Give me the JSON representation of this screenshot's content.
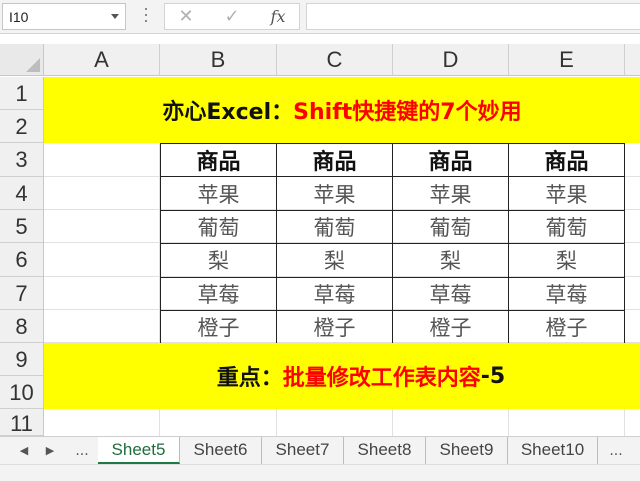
{
  "name_box": {
    "value": "I10"
  },
  "formula_bar": {
    "cancel_icon": "✕",
    "enter_icon": "✓",
    "fx_label": "fx",
    "value": ""
  },
  "columns": [
    "A",
    "B",
    "C",
    "D",
    "E"
  ],
  "rows": [
    "1",
    "2",
    "3",
    "4",
    "5",
    "6",
    "7",
    "8",
    "9",
    "10",
    "11"
  ],
  "title_banner": {
    "part1": "亦心Excel：",
    "part2": "Shift快捷键的7个妙用"
  },
  "table": {
    "header": [
      "商品",
      "商品",
      "商品",
      "商品"
    ],
    "rows": [
      [
        "苹果",
        "苹果",
        "苹果",
        "苹果"
      ],
      [
        "葡萄",
        "葡萄",
        "葡萄",
        "葡萄"
      ],
      [
        "梨",
        "梨",
        "梨",
        "梨"
      ],
      [
        "草莓",
        "草莓",
        "草莓",
        "草莓"
      ],
      [
        "橙子",
        "橙子",
        "橙子",
        "橙子"
      ]
    ]
  },
  "bottom_banner": {
    "part1": "重点：",
    "part2": "批量修改工作表内容",
    "part3": "-5"
  },
  "sheet_tabs": {
    "ellipsis": "...",
    "tabs": [
      "Sheet5",
      "Sheet6",
      "Sheet7",
      "Sheet8",
      "Sheet9",
      "Sheet10"
    ],
    "active": "Sheet5"
  },
  "colors": {
    "banner": "#ffff00",
    "highlight_text": "#ff0000",
    "active_tab": "#1e6e3c"
  }
}
